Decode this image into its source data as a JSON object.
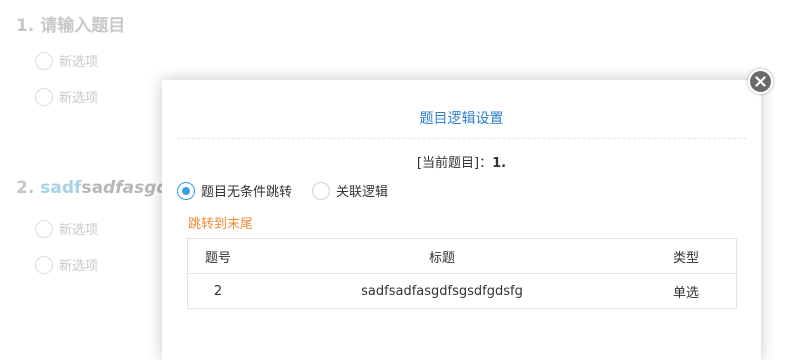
{
  "survey": {
    "q1": {
      "number": "1.",
      "title": "请输入题目",
      "options": [
        "新选项",
        "新选项"
      ]
    },
    "q2": {
      "number": "2.",
      "title_part1": "sadf",
      "title_part2": "sa",
      "title_part3": "dfasgd",
      "options": [
        "新选项",
        "新选项"
      ]
    }
  },
  "modal": {
    "title": "题目逻辑设置",
    "current_label": "[当前题目]：",
    "current_value": "1.",
    "radio_unconditional": "题目无条件跳转",
    "radio_related": "关联逻辑",
    "jump_text": "跳转到末尾",
    "table": {
      "headers": [
        "题号",
        "标题",
        "类型"
      ],
      "rows": [
        [
          "2",
          "sadfsadfasgdfsgsdfgdsfg",
          "单选"
        ]
      ]
    },
    "close_icon": "close-icon"
  },
  "colors": {
    "accent": "#3a9de0",
    "title_blue": "#2f7fcf",
    "jump_orange": "#f08a35"
  }
}
